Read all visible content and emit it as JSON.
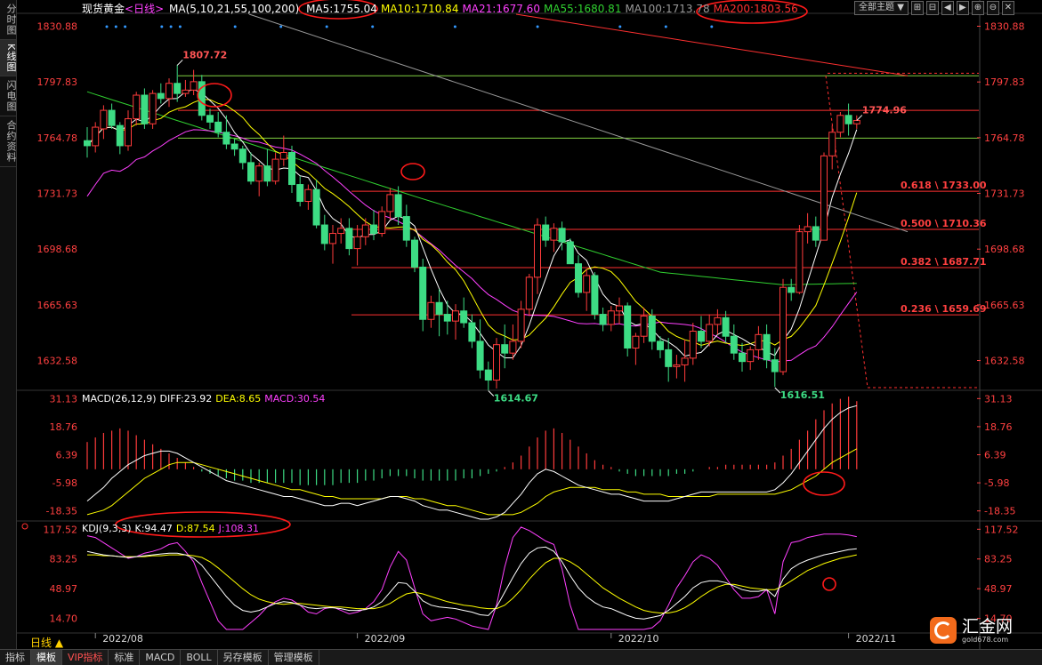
{
  "sidebar": {
    "tabs": [
      "分时图",
      "K线图",
      "闪电图",
      "合约资料"
    ],
    "active": 1
  },
  "header": {
    "instrument": "现货黄金",
    "period": "<日线>",
    "ma_prefix": "MA(5,10,21,55,100,200)",
    "ma_labels": [
      {
        "text": "MA5:1755.04",
        "color": "#ffffff"
      },
      {
        "text": "MA10:1710.84",
        "color": "#ffff00"
      },
      {
        "text": "MA21:1677.60",
        "color": "#ff40ff"
      },
      {
        "text": "MA55:1680.81",
        "color": "#30d030"
      },
      {
        "text": "MA100:1713.78",
        "color": "#999999"
      },
      {
        "text": "MA200:1803.56",
        "color": "#ff3030"
      }
    ]
  },
  "toolbar": {
    "theme_label": "全部主题",
    "theme_arrow": "▼",
    "buttons": [
      "⊞",
      "⊟",
      "◀",
      "▶",
      "⊕",
      "⊖",
      "✕"
    ]
  },
  "macd_label": {
    "name": "MACD(26,12,9)",
    "diff": "DIFF:23.92",
    "dea": "DEA:8.65",
    "macd": "MACD:30.54"
  },
  "kdj_label": {
    "name": "KDJ(9,3,3)",
    "k": "K:94.47",
    "d": "D:87.54",
    "j": "J:108.31"
  },
  "period_selector": "日线 ▲",
  "bottom_tabs": [
    "指标",
    "模板",
    "VIP指标",
    "标准",
    "MACD",
    "BOLL",
    "另存模板",
    "管理模板"
  ],
  "bottom_active": 1,
  "logo": {
    "name": "汇金网",
    "url": "gold678.com"
  },
  "colors": {
    "up": "#ff3b3b",
    "down": "#3ddc84",
    "grid": "#222222",
    "axis": "#ff4040"
  },
  "chart_data": [
    {
      "type": "candlestick",
      "ylim": [
        1616.0,
        1838.0
      ],
      "y_ticks": [
        1830.88,
        1797.83,
        1764.78,
        1731.73,
        1698.68,
        1665.63,
        1632.58
      ],
      "x_ticks": [
        "2022/08",
        "2022/09",
        "2022/10",
        "2022/11"
      ],
      "x_tick_index": [
        1,
        33,
        64,
        93
      ],
      "candles": [
        [
          1763,
          1771,
          1753,
          1760
        ],
        [
          1760,
          1774,
          1756,
          1771
        ],
        [
          1770,
          1784,
          1764,
          1781
        ],
        [
          1781,
          1785,
          1770,
          1772
        ],
        [
          1772,
          1774,
          1755,
          1760
        ],
        [
          1760,
          1781,
          1757,
          1776
        ],
        [
          1776,
          1792,
          1772,
          1790
        ],
        [
          1790,
          1794,
          1770,
          1773
        ],
        [
          1773,
          1793,
          1770,
          1791
        ],
        [
          1791,
          1797,
          1785,
          1788
        ],
        [
          1788,
          1800,
          1783,
          1797
        ],
        [
          1797,
          1808,
          1786,
          1791
        ],
        [
          1791,
          1799,
          1789,
          1793
        ],
        [
          1793,
          1805,
          1790,
          1798
        ],
        [
          1798,
          1802,
          1775,
          1778
        ],
        [
          1778,
          1782,
          1770,
          1774
        ],
        [
          1774,
          1780,
          1765,
          1768
        ],
        [
          1768,
          1778,
          1758,
          1761
        ],
        [
          1761,
          1764,
          1754,
          1758
        ],
        [
          1758,
          1760,
          1746,
          1750
        ],
        [
          1750,
          1756,
          1737,
          1739
        ],
        [
          1739,
          1750,
          1730,
          1748
        ],
        [
          1748,
          1758,
          1736,
          1739
        ],
        [
          1739,
          1756,
          1737,
          1752
        ],
        [
          1752,
          1766,
          1748,
          1756
        ],
        [
          1756,
          1760,
          1732,
          1737
        ],
        [
          1737,
          1742,
          1724,
          1727
        ],
        [
          1727,
          1737,
          1722,
          1734
        ],
        [
          1734,
          1740,
          1711,
          1713
        ],
        [
          1713,
          1719,
          1698,
          1702
        ],
        [
          1702,
          1713,
          1690,
          1708
        ],
        [
          1708,
          1717,
          1702,
          1711
        ],
        [
          1711,
          1717,
          1695,
          1699
        ],
        [
          1699,
          1713,
          1689,
          1706
        ],
        [
          1706,
          1717,
          1701,
          1713
        ],
        [
          1713,
          1722,
          1704,
          1708
        ],
        [
          1708,
          1724,
          1706,
          1721
        ],
        [
          1721,
          1735,
          1716,
          1731
        ],
        [
          1731,
          1736,
          1713,
          1718
        ],
        [
          1718,
          1725,
          1700,
          1704
        ],
        [
          1704,
          1706,
          1685,
          1688
        ],
        [
          1688,
          1693,
          1650,
          1657
        ],
        [
          1657,
          1671,
          1652,
          1667
        ],
        [
          1667,
          1675,
          1647,
          1660
        ],
        [
          1660,
          1668,
          1648,
          1656
        ],
        [
          1656,
          1666,
          1645,
          1662
        ],
        [
          1662,
          1670,
          1652,
          1655
        ],
        [
          1655,
          1660,
          1640,
          1644
        ],
        [
          1644,
          1657,
          1622,
          1627
        ],
        [
          1627,
          1632,
          1615,
          1621
        ],
        [
          1621,
          1646,
          1616,
          1642
        ],
        [
          1642,
          1654,
          1628,
          1637
        ],
        [
          1637,
          1654,
          1633,
          1644
        ],
        [
          1644,
          1668,
          1640,
          1663
        ],
        [
          1663,
          1684,
          1659,
          1682
        ],
        [
          1682,
          1717,
          1672,
          1713
        ],
        [
          1713,
          1718,
          1700,
          1704
        ],
        [
          1704,
          1714,
          1697,
          1711
        ],
        [
          1711,
          1715,
          1698,
          1703
        ],
        [
          1703,
          1705,
          1690,
          1690
        ],
        [
          1690,
          1695,
          1670,
          1673
        ],
        [
          1673,
          1687,
          1662,
          1683
        ],
        [
          1683,
          1685,
          1657,
          1660
        ],
        [
          1660,
          1664,
          1650,
          1654
        ],
        [
          1654,
          1665,
          1650,
          1662
        ],
        [
          1662,
          1670,
          1654,
          1665
        ],
        [
          1665,
          1667,
          1635,
          1640
        ],
        [
          1640,
          1649,
          1630,
          1647
        ],
        [
          1647,
          1664,
          1643,
          1659
        ],
        [
          1659,
          1663,
          1639,
          1644
        ],
        [
          1644,
          1647,
          1634,
          1639
        ],
        [
          1639,
          1646,
          1620,
          1629
        ],
        [
          1629,
          1636,
          1622,
          1630
        ],
        [
          1630,
          1645,
          1620,
          1634
        ],
        [
          1634,
          1655,
          1630,
          1650
        ],
        [
          1650,
          1659,
          1640,
          1644
        ],
        [
          1644,
          1660,
          1641,
          1654
        ],
        [
          1654,
          1663,
          1648,
          1658
        ],
        [
          1658,
          1662,
          1643,
          1647
        ],
        [
          1647,
          1654,
          1633,
          1637
        ],
        [
          1637,
          1643,
          1626,
          1632
        ],
        [
          1632,
          1641,
          1627,
          1639
        ],
        [
          1639,
          1653,
          1633,
          1648
        ],
        [
          1648,
          1654,
          1628,
          1633
        ],
        [
          1633,
          1640,
          1617,
          1626
        ],
        [
          1626,
          1681,
          1624,
          1676
        ],
        [
          1676,
          1681,
          1668,
          1673
        ],
        [
          1673,
          1713,
          1672,
          1709
        ],
        [
          1709,
          1720,
          1702,
          1712
        ],
        [
          1712,
          1718,
          1700,
          1704
        ],
        [
          1704,
          1756,
          1704,
          1754
        ],
        [
          1754,
          1772,
          1746,
          1768
        ],
        [
          1768,
          1780,
          1765,
          1778
        ],
        [
          1778,
          1785,
          1766,
          1773
        ],
        [
          1773,
          1778,
          1770,
          1775
        ]
      ],
      "labels": [
        {
          "text": "1807.72",
          "index": 11,
          "price": 1807.72,
          "color": "#ff5555"
        },
        {
          "text": "1614.67",
          "index": 49,
          "price": 1614.67,
          "color": "#3ddc84"
        },
        {
          "text": "1616.51",
          "index": 84,
          "price": 1616.51,
          "color": "#3ddc84"
        },
        {
          "text": "1774.96",
          "index": 94,
          "price": 1774.96,
          "color": "#ff5555"
        }
      ],
      "fibonacci": [
        {
          "text": "0.618 \\ 1733.00",
          "price": 1733.0
        },
        {
          "text": "0.500 \\ 1710.36",
          "price": 1710.36
        },
        {
          "text": "0.382 \\ 1687.71",
          "price": 1687.71
        },
        {
          "text": "0.236 \\ 1659.69",
          "price": 1659.69
        }
      ],
      "h_lines": [
        {
          "price": 1801.5,
          "color": "#80d040"
        },
        {
          "price": 1781.0,
          "color": "#ff3030"
        },
        {
          "price": 1764.5,
          "color": "#80d040"
        }
      ],
      "ma200": [
        1838.0,
        1801.5
      ],
      "ma100": [
        1838.0,
        1709.0
      ]
    },
    {
      "type": "macd",
      "ylim": [
        -22.0,
        34.0
      ],
      "y_ticks": [
        31.13,
        18.76,
        6.39,
        -5.98,
        -18.35
      ],
      "hist": [
        12,
        14,
        16,
        17,
        18,
        17,
        15,
        13,
        11,
        9,
        7,
        5,
        3,
        1,
        -1,
        -2,
        -3,
        -4,
        -5,
        -5,
        -6,
        -6,
        -6,
        -6,
        -6,
        -6,
        -7,
        -7,
        -7,
        -7,
        -7,
        -6,
        -6,
        -6,
        -5,
        -5,
        -4,
        -3,
        -3,
        -3,
        -4,
        -5,
        -5,
        -5,
        -5,
        -5,
        -4,
        -4,
        -3,
        -2,
        -1,
        1,
        3,
        6,
        10,
        14,
        17,
        18,
        16,
        13,
        10,
        7,
        4,
        2,
        1,
        -1,
        -2,
        -3,
        -3,
        -3,
        -3,
        -3,
        -2,
        -2,
        -1,
        0,
        1,
        1,
        2,
        2,
        2,
        2,
        2,
        2,
        3,
        6,
        9,
        13,
        17,
        22,
        26,
        29,
        31,
        32,
        30
      ],
      "diff": [
        -14,
        -11,
        -8,
        -4,
        -1,
        2,
        4,
        6,
        7,
        8,
        8,
        7,
        5,
        3,
        1,
        -1,
        -3,
        -5,
        -6,
        -7,
        -8,
        -9,
        -10,
        -11,
        -12,
        -12,
        -13,
        -14,
        -15,
        -16,
        -16,
        -15,
        -15,
        -16,
        -15,
        -14,
        -13,
        -12,
        -12,
        -13,
        -14,
        -16,
        -17,
        -18,
        -18,
        -19,
        -20,
        -21,
        -22,
        -22,
        -21,
        -19,
        -15,
        -11,
        -6,
        -2,
        0,
        -1,
        -3,
        -5,
        -7,
        -8,
        -9,
        -10,
        -11,
        -11,
        -12,
        -13,
        -14,
        -14,
        -14,
        -14,
        -13,
        -12,
        -11,
        -10,
        -10,
        -10,
        -10,
        -10,
        -10,
        -10,
        -10,
        -10,
        -9,
        -6,
        -2,
        3,
        8,
        13,
        18,
        22,
        25,
        27,
        28
      ],
      "dea": [
        -20,
        -19,
        -18,
        -16,
        -13,
        -10,
        -7,
        -4,
        -2,
        0,
        2,
        3,
        3,
        3,
        2,
        1,
        0,
        -1,
        -2,
        -3,
        -4,
        -5,
        -6,
        -7,
        -8,
        -9,
        -9,
        -10,
        -11,
        -12,
        -12,
        -13,
        -13,
        -13,
        -13,
        -13,
        -13,
        -12,
        -12,
        -12,
        -13,
        -13,
        -14,
        -15,
        -16,
        -16,
        -17,
        -18,
        -19,
        -20,
        -20,
        -20,
        -20,
        -19,
        -17,
        -15,
        -12,
        -10,
        -9,
        -8,
        -8,
        -8,
        -8,
        -9,
        -9,
        -9,
        -10,
        -10,
        -11,
        -11,
        -11,
        -12,
        -12,
        -12,
        -12,
        -12,
        -12,
        -11,
        -11,
        -11,
        -11,
        -11,
        -11,
        -11,
        -11,
        -10,
        -9,
        -7,
        -5,
        -3,
        0,
        3,
        5,
        7,
        9
      ]
    },
    {
      "type": "kdj",
      "ylim": [
        0.0,
        125.0
      ],
      "y_ticks": [
        117.52,
        83.25,
        48.97,
        14.7
      ],
      "k": [
        92,
        90,
        88,
        87,
        86,
        85,
        86,
        87,
        88,
        89,
        90,
        90,
        88,
        84,
        76,
        64,
        52,
        40,
        30,
        24,
        22,
        24,
        28,
        32,
        34,
        33,
        30,
        27,
        26,
        27,
        27,
        26,
        24,
        24,
        25,
        28,
        34,
        45,
        56,
        55,
        46,
        35,
        30,
        28,
        27,
        26,
        24,
        22,
        19,
        18,
        28,
        45,
        62,
        78,
        90,
        96,
        97,
        92,
        80,
        64,
        50,
        40,
        33,
        28,
        26,
        22,
        18,
        15,
        14,
        16,
        18,
        24,
        32,
        40,
        50,
        56,
        58,
        58,
        56,
        52,
        48,
        46,
        46,
        48,
        40,
        60,
        72,
        78,
        82,
        85,
        88,
        90,
        92,
        94,
        95
      ],
      "d": [
        88,
        88,
        87,
        87,
        86,
        86,
        86,
        86,
        87,
        87,
        88,
        88,
        88,
        87,
        85,
        80,
        73,
        65,
        57,
        49,
        42,
        37,
        34,
        32,
        31,
        32,
        32,
        31,
        30,
        29,
        28,
        28,
        27,
        26,
        26,
        26,
        28,
        32,
        38,
        43,
        45,
        43,
        40,
        37,
        34,
        32,
        30,
        29,
        27,
        26,
        26,
        30,
        38,
        48,
        60,
        70,
        79,
        84,
        84,
        80,
        74,
        66,
        58,
        50,
        44,
        38,
        33,
        28,
        24,
        22,
        21,
        21,
        23,
        27,
        33,
        40,
        46,
        51,
        54,
        54,
        52,
        50,
        49,
        48,
        48,
        52,
        58,
        64,
        70,
        74,
        78,
        81,
        84,
        86,
        88
      ],
      "j": [
        110,
        108,
        102,
        96,
        90,
        84,
        86,
        90,
        92,
        95,
        100,
        102,
        92,
        80,
        56,
        34,
        12,
        -2,
        -4,
        2,
        10,
        18,
        28,
        34,
        38,
        36,
        30,
        22,
        20,
        26,
        28,
        24,
        20,
        22,
        26,
        34,
        48,
        74,
        92,
        82,
        50,
        20,
        12,
        14,
        16,
        14,
        10,
        6,
        4,
        2,
        30,
        74,
        108,
        120,
        116,
        110,
        104,
        100,
        72,
        30,
        0,
        -6,
        -6,
        -4,
        -4,
        -8,
        -10,
        -12,
        -6,
        4,
        12,
        30,
        50,
        64,
        80,
        88,
        84,
        76,
        62,
        48,
        38,
        38,
        40,
        48,
        20,
        80,
        102,
        104,
        108,
        110,
        112,
        112,
        112,
        111,
        109
      ]
    }
  ]
}
